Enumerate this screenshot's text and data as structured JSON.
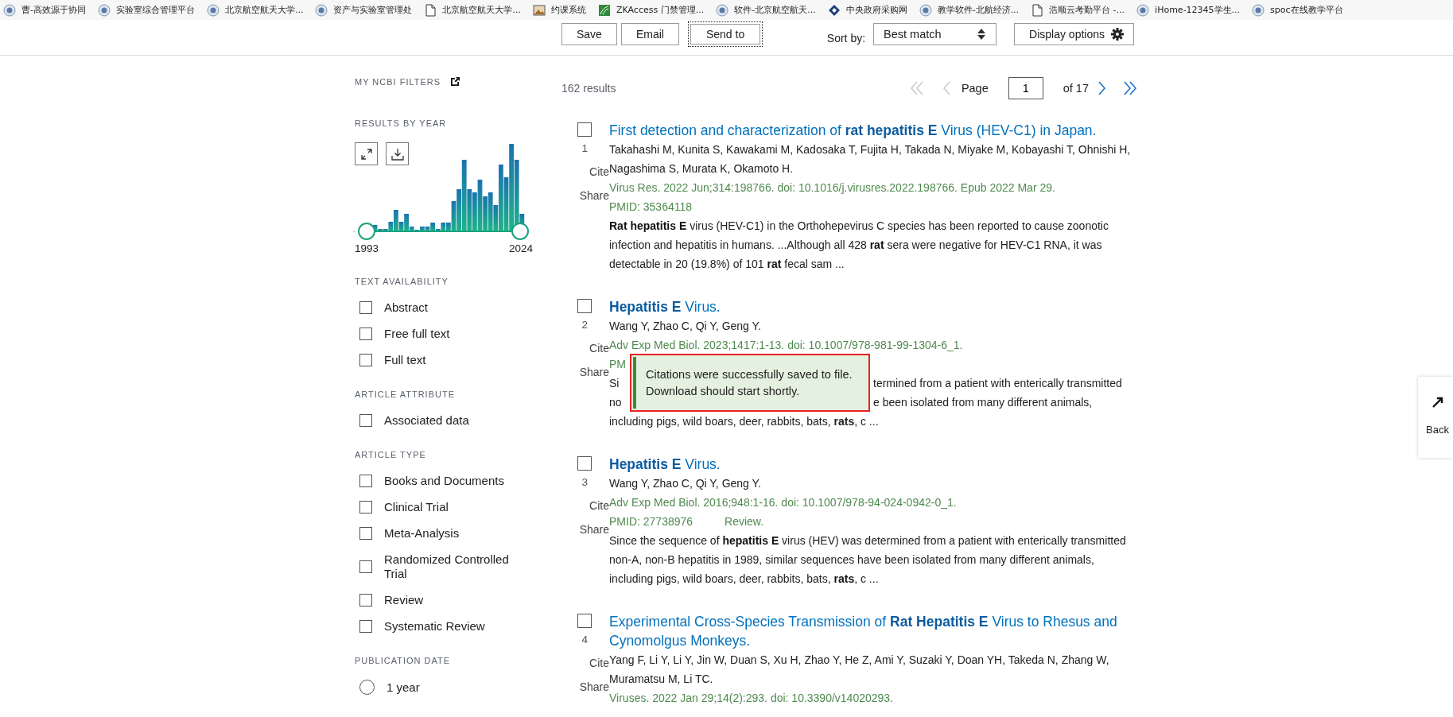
{
  "bookmarks": [
    {
      "label": "曹-高效源于协同",
      "kind": "seal"
    },
    {
      "label": "实验室综合管理平台",
      "kind": "seal"
    },
    {
      "label": "北京航空航天大学...",
      "kind": "seal"
    },
    {
      "label": "资产与实验室管理处",
      "kind": "seal"
    },
    {
      "label": "北京航空航天大学...",
      "kind": "page"
    },
    {
      "label": "约课系统",
      "kind": "photo"
    },
    {
      "label": "ZKAccess 门禁管理...",
      "kind": "green"
    },
    {
      "label": "软件-北京航空航天...",
      "kind": "seal"
    },
    {
      "label": "中央政府采购网",
      "kind": "diamond"
    },
    {
      "label": "教学软件-北航经济...",
      "kind": "seal"
    },
    {
      "label": "浩顺云考勤平台 -...",
      "kind": "page"
    },
    {
      "label": "iHome-12345学生...",
      "kind": "seal"
    },
    {
      "label": "spoc在线教学平台",
      "kind": "seal"
    }
  ],
  "toolbar": {
    "buttons": [
      {
        "label": "Save",
        "focused": false
      },
      {
        "label": "Email",
        "focused": false
      },
      {
        "label": "Send to",
        "focused": true
      }
    ],
    "sort_label": "Sort by:",
    "sort_value": "Best match",
    "display_options": "Display options"
  },
  "sidebar": {
    "my_filters": "MY NCBI FILTERS",
    "results_by_year": {
      "title": "RESULTS BY YEAR",
      "start_year": "1993",
      "end_year": "2024",
      "level": 1
    },
    "sections": [
      {
        "title": "TEXT AVAILABILITY",
        "kind": "checkbox",
        "options": [
          {
            "label": "Abstract",
            "checked": false
          },
          {
            "label": "Free full text",
            "checked": false
          },
          {
            "label": "Full text",
            "checked": false
          }
        ]
      },
      {
        "title": "ARTICLE ATTRIBUTE",
        "kind": "checkbox",
        "options": [
          {
            "label": "Associated data",
            "checked": false
          }
        ]
      },
      {
        "title": "ARTICLE TYPE",
        "kind": "checkbox",
        "options": [
          {
            "label": "Books and Documents",
            "checked": false
          },
          {
            "label": "Clinical Trial",
            "checked": false
          },
          {
            "label": "Meta-Analysis",
            "checked": false
          },
          {
            "label": "Randomized Controlled Trial",
            "checked": false
          },
          {
            "label": "Review",
            "checked": false
          },
          {
            "label": "Systematic Review",
            "checked": false
          }
        ]
      },
      {
        "title": "PUBLICATION DATE",
        "kind": "radio",
        "options": [
          {
            "label": "1 year",
            "checked": false
          }
        ]
      }
    ]
  },
  "results": {
    "count": "162 results",
    "pagination": {
      "page_label": "Page",
      "page": "1",
      "of": "of 17",
      "controls": [
        {
          "kind": "first",
          "disabled": true
        },
        {
          "kind": "prev",
          "disabled": true
        },
        {
          "kind": "next",
          "disabled": false
        },
        {
          "kind": "last",
          "disabled": false
        }
      ]
    },
    "items": [
      {
        "kind": "full",
        "number": "1",
        "checked": false,
        "cite": "Cite",
        "share": "Share",
        "title": "First detection and characterization of **rat hepatitis E** Virus (HEV-C1) in Japan.",
        "authors": "Takahashi M, Kunita S, Kawakami M, Kadosaka T, Fujita H, Takada N, Miyake M, Kobayashi T, Ohnishi H, Nagashima S, Murata K, Okamoto H.",
        "citation": "Virus Res. 2022 Jun;314:198766. doi: 10.1016/j.virusres.2022.198766. Epub 2022 Mar 29.",
        "pmid": "PMID: 35364118",
        "abstract": "**Rat hepatitis E** virus (HEV-C1) in the Orthohepevirus C species has been reported to cause zoonotic infection and hepatitis in humans. ...Although all 428 **rat** sera were negative for HEV-C1 RNA, it was detectable in 20 (19.8%) of 101 **rat** fecal sam ..."
      },
      {
        "kind": "covered",
        "number": "2",
        "checked": false,
        "cite": "Cite",
        "share": "Share",
        "title": "**Hepatitis E** Virus.",
        "authors": "Wang Y, Zhao C, Qi Y, Geng Y.",
        "citation": "Adv Exp Med Biol. 2023;1417:1-13. doi: 10.1007/978-981-99-1304-6_1.",
        "pmid": "PM",
        "abstract_lines": [
          {
            "left": "Si",
            "right": "termined from a patient with enterically transmitted"
          },
          {
            "left": "no",
            "right": "e been isolated from many different animals,"
          },
          {
            "left": "including pigs, wild boars, deer, rabbits, bats, **rats**, c ..."
          }
        ]
      },
      {
        "kind": "full",
        "number": "3",
        "checked": false,
        "cite": "Cite",
        "share": "Share",
        "title": "**Hepatitis E** Virus.",
        "authors": "Wang Y, Zhao C, Qi Y, Geng Y.",
        "citation": "Adv Exp Med Biol. 2016;948:1-16. doi: 10.1007/978-94-024-0942-0_1.",
        "pmid": "PMID: 27738976",
        "tag": {
          "text": "Review.",
          "color": "#4f8a4f"
        },
        "abstract": "Since the sequence of **hepatitis E** virus (HEV) was determined from a patient with enterically transmitted non-A, non-B hepatitis in 1989, similar sequences have been isolated from many different animals, including pigs, wild boars, deer, rabbits, bats, **rats**, c ..."
      },
      {
        "kind": "full",
        "number": "4",
        "checked": false,
        "cite": "Cite",
        "share": "Share",
        "title": "Experimental Cross-Species Transmission of **Rat Hepatitis E** Virus to Rhesus and Cynomolgus Monkeys.",
        "authors": "Yang F, Li Y, Li Y, Jin W, Duan S, Xu H, Zhao Y, He Z, Ami Y, Suzaki Y, Doan YH, Takeda N, Zhang W, Muramatsu M, Li TC.",
        "citation": "Viruses. 2022 Jan 29;14(2):293. doi: 10.3390/v14020293."
      }
    ]
  },
  "toast": {
    "message": "Citations were successfully saved to file. Download should start shortly."
  },
  "back_widget": {
    "label": "Back"
  }
}
